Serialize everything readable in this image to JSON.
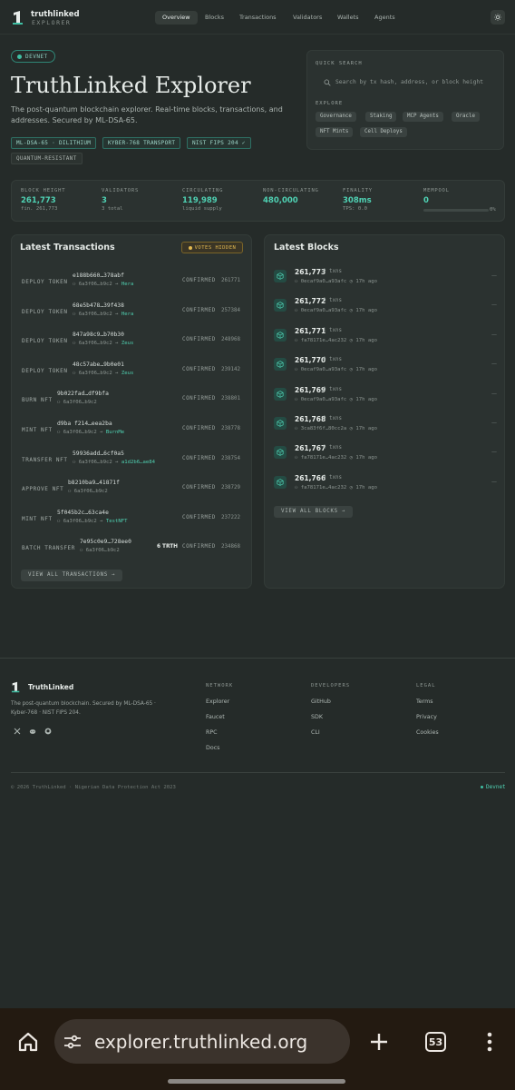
{
  "nav": {
    "brand": "truthlinked",
    "brand_sub": "EXPLORER",
    "tabs": [
      "Overview",
      "Blocks",
      "Transactions",
      "Validators",
      "Wallets",
      "Agents"
    ]
  },
  "hero": {
    "network_badge": "DEVNET",
    "title": "TruthLinked Explorer",
    "description": "The post-quantum blockchain explorer. Real-time blocks, transactions, and addresses. Secured by ML-DSA-65.",
    "tags": [
      "ML-DSA-65 · DILITHIUM",
      "KYBER-768 TRANSPORT",
      "NIST FIPS 204 ✓",
      "QUANTUM-RESISTANT"
    ]
  },
  "quick_search": {
    "label": "QUICK SEARCH",
    "placeholder": "Search by tx hash, address, or block height",
    "explore_label": "EXPLORE",
    "chips": [
      "Governance",
      "Staking",
      "MCP Agents",
      "Oracle",
      "NFT Mints",
      "Cell Deploys"
    ]
  },
  "stats": [
    {
      "label": "BLOCK HEIGHT",
      "value": "261,773",
      "sub": "fin. 261,773"
    },
    {
      "label": "VALIDATORS",
      "value": "3",
      "sub": "3 total"
    },
    {
      "label": "CIRCULATING",
      "value": "119,989",
      "sub": "liquid supply"
    },
    {
      "label": "NON-CIRCULATING",
      "value": "480,000",
      "sub": ""
    },
    {
      "label": "FINALITY",
      "value": "308ms",
      "sub": "TPS: 0.0"
    },
    {
      "label": "MEMPOOL",
      "value": "0",
      "sub": "0%",
      "fill": 0
    }
  ],
  "latest_tx": {
    "title": "Latest Transactions",
    "badge": "VOTES HIDDEN",
    "button": "VIEW ALL TRANSACTIONS →",
    "rows": [
      {
        "type": "DEPLOY TOKEN",
        "hash": "e188b660…378abf",
        "from": "6a3f06…b9c2",
        "arrow": "→",
        "to": "Hera",
        "amount": "",
        "status": "CONFIRMED",
        "block": "261771"
      },
      {
        "type": "DEPLOY TOKEN",
        "hash": "68e5b478…39f438",
        "from": "6a3f06…b9c2",
        "arrow": "→",
        "to": "Hera",
        "amount": "",
        "status": "CONFIRMED",
        "block": "257384"
      },
      {
        "type": "DEPLOY TOKEN",
        "hash": "847a98c9…b70b30",
        "from": "6a3f06…b9c2",
        "arrow": "→",
        "to": "Zeus",
        "amount": "",
        "status": "CONFIRMED",
        "block": "248968"
      },
      {
        "type": "DEPLOY TOKEN",
        "hash": "48c57abe…9b0e01",
        "from": "6a3f06…b9c2",
        "arrow": "→",
        "to": "Zeus",
        "amount": "",
        "status": "CONFIRMED",
        "block": "239142"
      },
      {
        "type": "BURN NFT",
        "hash": "9b022fad…df9bfa",
        "from": "6a3f06…b9c2",
        "arrow": "",
        "to": "",
        "amount": "",
        "status": "CONFIRMED",
        "block": "238801"
      },
      {
        "type": "MINT NFT",
        "hash": "d9ba f214…eea2ba",
        "from": "6a3f06…b9c2",
        "arrow": "→",
        "to": "BurnMe",
        "amount": "",
        "status": "CONFIRMED",
        "block": "238778"
      },
      {
        "type": "TRANSFER NFT",
        "hash": "59936add…6cf0a5",
        "from": "6a3f06…b9c2",
        "arrow": "→",
        "to": "a1d2b6…ae84",
        "amount": "",
        "status": "CONFIRMED",
        "block": "238754"
      },
      {
        "type": "APPROVE NFT",
        "hash": "b8210ba9…41871f",
        "from": "6a3f06…b9c2",
        "arrow": "",
        "to": "",
        "amount": "",
        "status": "CONFIRMED",
        "block": "238729"
      },
      {
        "type": "MINT NFT",
        "hash": "5f045b2c…63ca4e",
        "from": "6a3f06…b9c2",
        "arrow": "→",
        "to": "TestNFT",
        "amount": "",
        "status": "CONFIRMED",
        "block": "237222"
      },
      {
        "type": "BATCH TRANSFER",
        "hash": "7e95c0e9…728ee0",
        "from": "6a3f06…b9c2",
        "arrow": "",
        "to": "",
        "amount": "6 TRTH",
        "status": "CONFIRMED",
        "block": "234868"
      }
    ]
  },
  "latest_blocks": {
    "title": "Latest Blocks",
    "button": "VIEW ALL BLOCKS →",
    "rows": [
      {
        "number": "261,773",
        "txns": "0 txns",
        "proposer": "0ecaf9a0…a93afc",
        "age": "17h ago",
        "dash": "—"
      },
      {
        "number": "261,772",
        "txns": "0 txns",
        "proposer": "0ecaf9a0…a93afc",
        "age": "17h ago",
        "dash": "—"
      },
      {
        "number": "261,771",
        "txns": "1 txns",
        "proposer": "fa78171e…4ac232",
        "age": "17h ago",
        "dash": "—"
      },
      {
        "number": "261,770",
        "txns": "0 txns",
        "proposer": "0ecaf9a0…a93afc",
        "age": "17h ago",
        "dash": "—"
      },
      {
        "number": "261,769",
        "txns": "0 txns",
        "proposer": "0ecaf9a0…a93afc",
        "age": "17h ago",
        "dash": "—"
      },
      {
        "number": "261,768",
        "txns": "0 txns",
        "proposer": "3ca83f6f…80cc2a",
        "age": "17h ago",
        "dash": "—"
      },
      {
        "number": "261,767",
        "txns": "0 txns",
        "proposer": "fa78171e…4ac232",
        "age": "17h ago",
        "dash": "—"
      },
      {
        "number": "261,766",
        "txns": "0 txns",
        "proposer": "fa78171e…4ac232",
        "age": "17h ago",
        "dash": "—"
      }
    ]
  },
  "footer": {
    "brand": "TruthLinked",
    "description": "The post-quantum blockchain. Secured by ML-DSA-65 · Kyber-768 · NIST FIPS 204.",
    "columns": [
      {
        "heading": "NETWORK",
        "links": [
          "Explorer",
          "Faucet",
          "RPC",
          "Docs"
        ]
      },
      {
        "heading": "DEVELOPERS",
        "links": [
          "GitHub",
          "SDK",
          "CLI"
        ]
      },
      {
        "heading": "LEGAL",
        "links": [
          "Terms",
          "Privacy",
          "Cookies"
        ]
      }
    ],
    "copyright": "© 2026 TruthLinked · Nigerian Data Protection Act 2023",
    "network": "Devnet"
  },
  "browser": {
    "url": "explorer.truthlinked.org",
    "tab_count": "53"
  },
  "colors": {
    "accent": "#4fd1b3",
    "background": "#252b29",
    "card": "#2b3230",
    "warning": "#e3b950"
  }
}
